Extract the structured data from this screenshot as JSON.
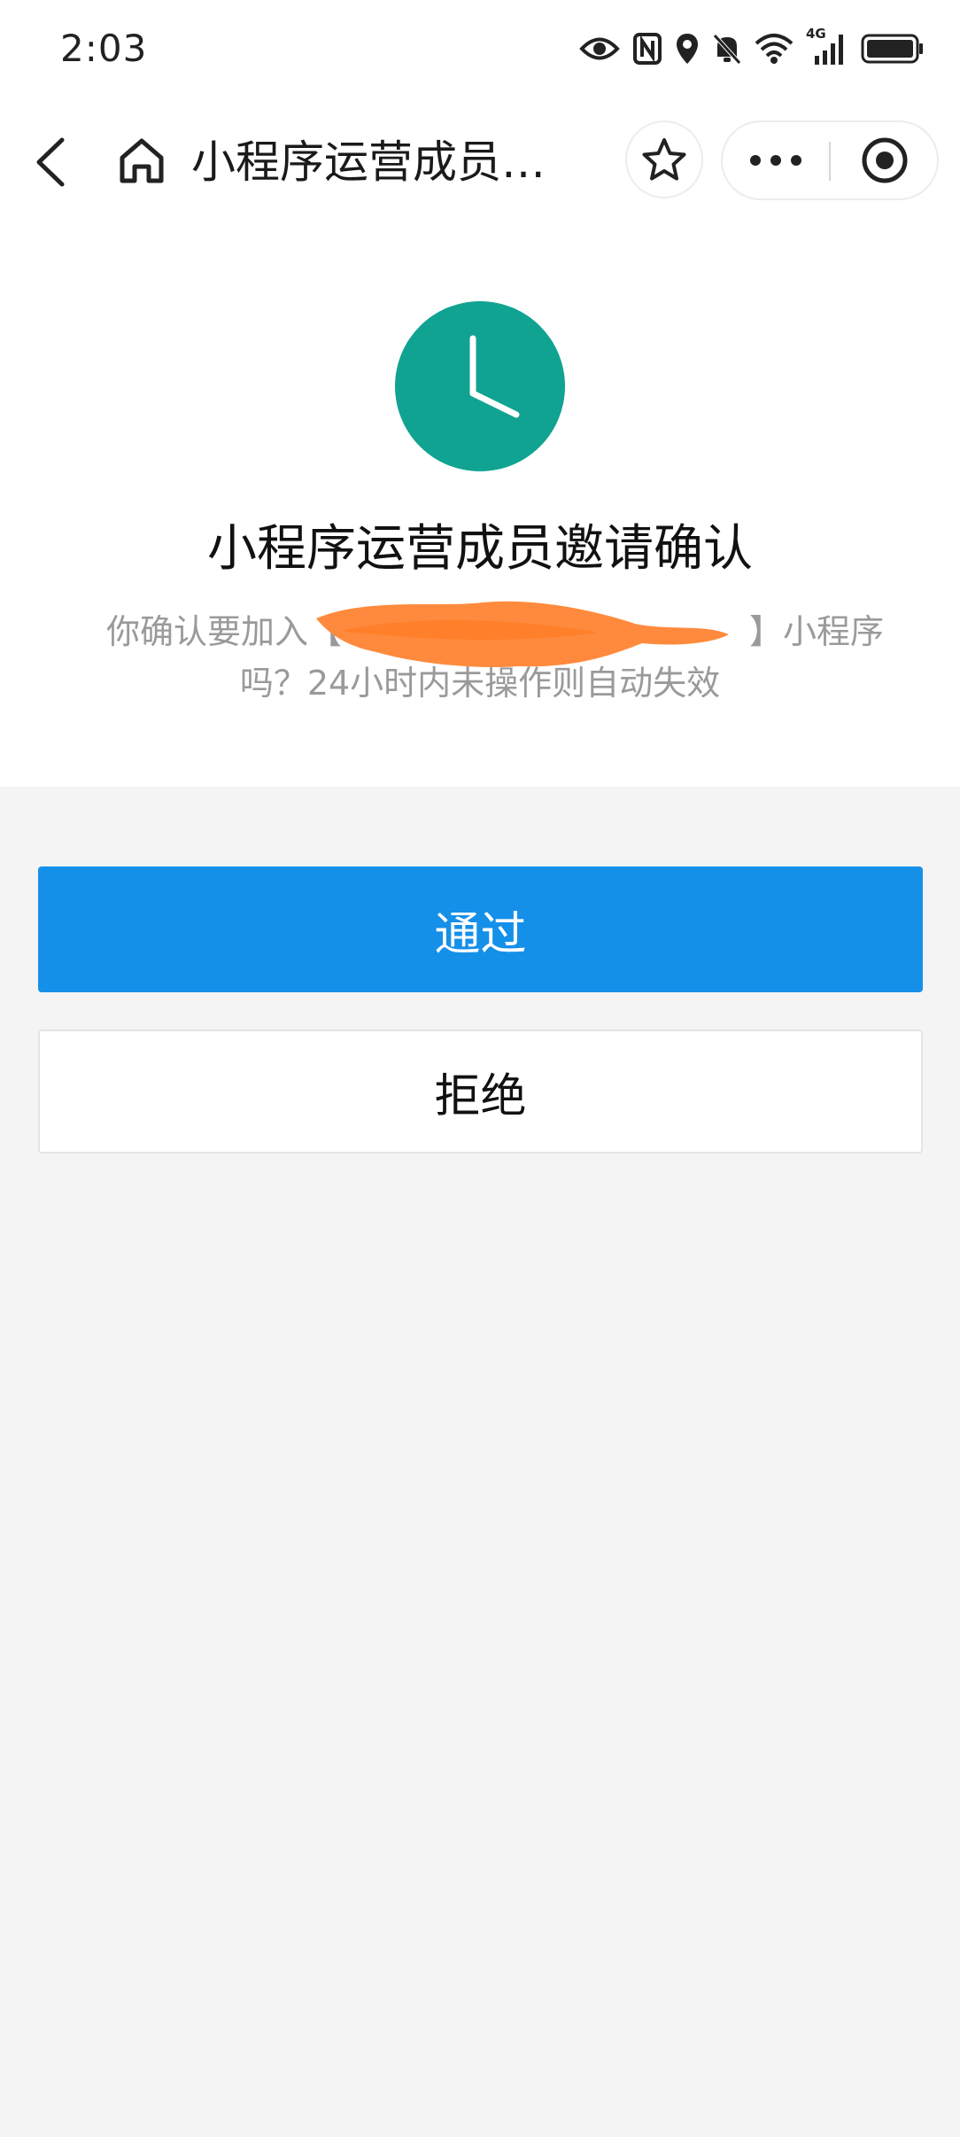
{
  "status_bar": {
    "time": "2:03",
    "network_label": "4G",
    "icons": [
      "eye-icon",
      "nfc-icon",
      "location-icon",
      "mute-bell-icon",
      "wifi-icon",
      "signal-icon",
      "battery-icon"
    ]
  },
  "nav": {
    "title": "小程序运营成员邀请确认",
    "icons": [
      "back-icon",
      "home-icon",
      "star-icon",
      "more-icon",
      "close-capsule-icon"
    ]
  },
  "main": {
    "icon": "clock-icon",
    "icon_color": "#10a391",
    "heading": "小程序运营成员邀请确认",
    "desc_line1": "你确认要加入【",
    "desc_line1_end": "】小程序",
    "desc_line2": "吗？24小时内未操作则自动失效",
    "redaction_color": "#ff8a3d"
  },
  "actions": {
    "approve_label": "通过",
    "reject_label": "拒绝",
    "approve_color": "#1590e9"
  }
}
